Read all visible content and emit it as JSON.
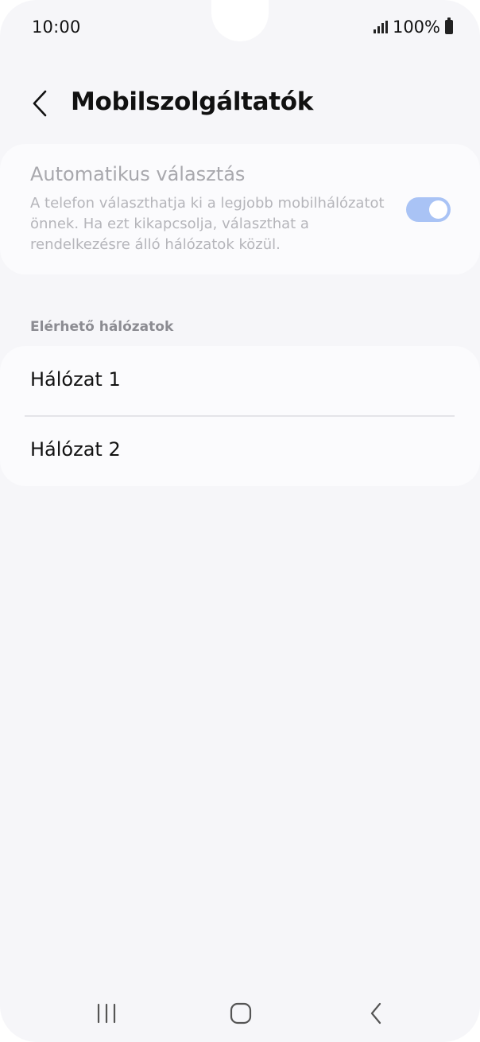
{
  "status_bar": {
    "time": "10:00",
    "battery_percent": "100%",
    "signal_icon": "signal-bars-icon",
    "battery_icon": "battery-full-icon"
  },
  "header": {
    "title": "Mobilszolgáltatók",
    "back_icon": "chevron-left-icon"
  },
  "auto_select": {
    "title": "Automatikus választás",
    "description": "A telefon választhatja ki a legjobb mobilhálózatot önnek. Ha ezt kikapcsolja, választhat a rendelkezésre álló hálózatok közül.",
    "enabled": true,
    "disabled_appearance": true,
    "toggle_color": "#a9c3f5"
  },
  "networks": {
    "section_label": "Elérhető hálózatok",
    "items": [
      {
        "label": "Hálózat 1"
      },
      {
        "label": "Hálózat 2"
      }
    ]
  },
  "nav_bar": {
    "recents_icon": "recents-icon",
    "home_icon": "home-icon",
    "back_icon": "back-icon"
  },
  "colors": {
    "background": "#f6f6f9",
    "card": "#fbfbfd",
    "disabled_text": "#a8a8ad"
  }
}
